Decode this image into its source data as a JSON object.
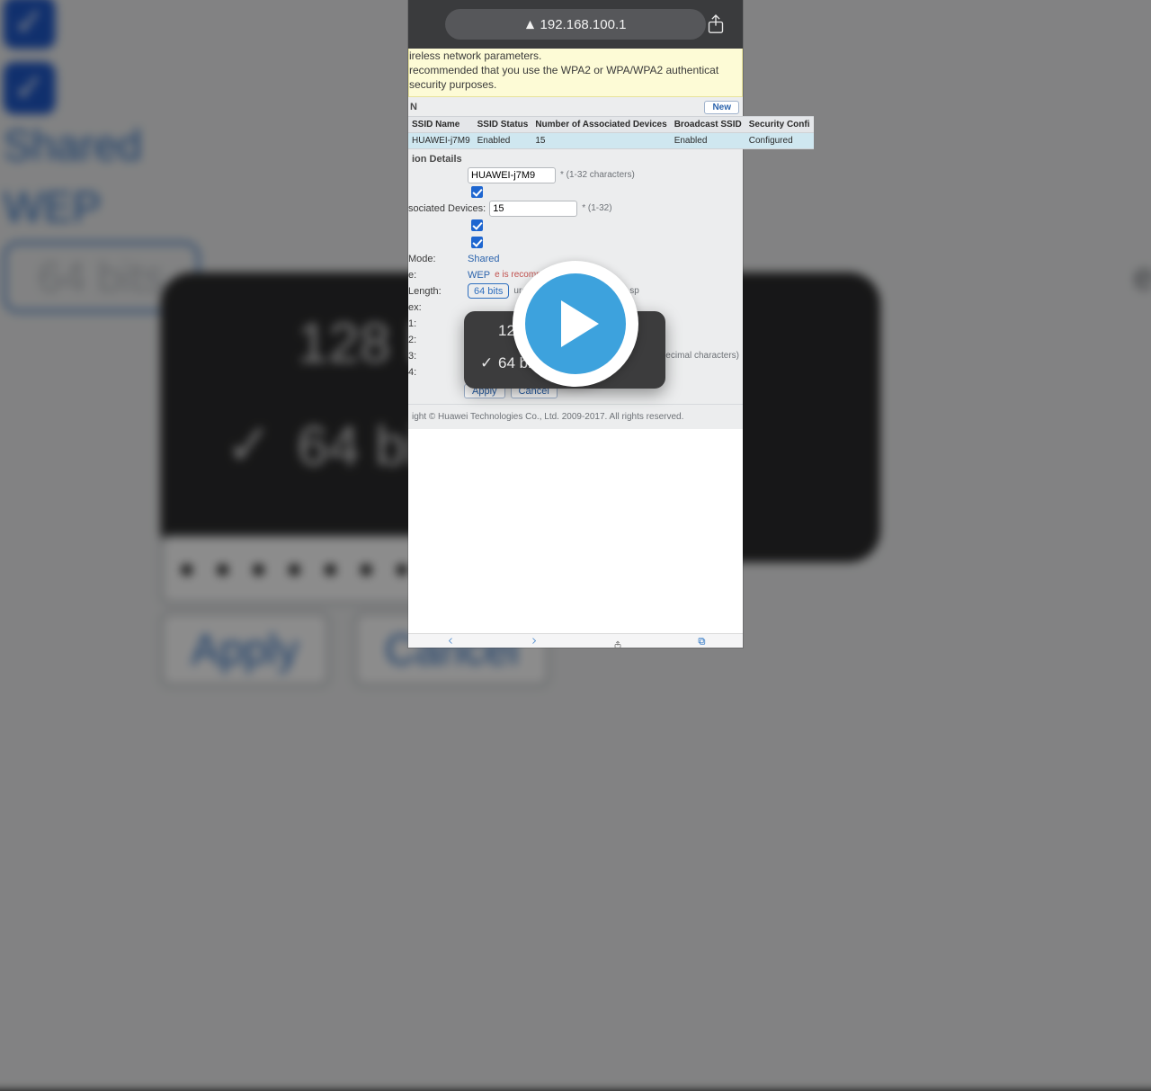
{
  "top": {
    "address": "192.168.100.1"
  },
  "hint": {
    "l1": "ireless network parameters.",
    "l2": "recommended that you use the WPA2 or WPA/WPA2 authenticat",
    "l3": " security purposes."
  },
  "section_title": "N",
  "new_btn": "New",
  "table": {
    "headers": [
      "SSID Name",
      "SSID Status",
      "Number of Associated Devices",
      "Broadcast SSID",
      "Security Confi"
    ],
    "row": [
      "HUAWEI-j7M9",
      "Enabled",
      "15",
      "Enabled",
      "Configured"
    ]
  },
  "details_hdr": "ion Details",
  "fields": {
    "ssid_name": {
      "label": "",
      "value": "HUAWEI-j7M9",
      "note": "* (1-32 characters)"
    },
    "enable_ck": true,
    "assoc": {
      "label": "sociated Devices:",
      "value": "15",
      "note": "* (1-32)"
    },
    "ck2": true,
    "ck3": true,
    "mode": {
      "label": "Mode:",
      "value": "Shared"
    },
    "enc": {
      "label": "e:",
      "value": "WEP",
      "red": "e is recommended)"
    },
    "len": {
      "label": "Length:",
      "value": "64 bits",
      "gray": "ure but affect the connection sp"
    },
    "idx": {
      "label": "ex:"
    },
    "k1": {
      "label": "1:"
    },
    "k2": {
      "label": "2:"
    },
    "k3": {
      "label": "3:",
      "hx": "adecimal characters)"
    },
    "k4": {
      "label": "4:",
      "value": "•••••••••••••"
    }
  },
  "dropdown": {
    "opt0": "128",
    "opt1": "64 bit",
    "selected": 1
  },
  "apply": "Apply",
  "cancel": "Cancel",
  "copyright": "ight © Huawei Technologies Co., Ltd. 2009-2017. All rights reserved.",
  "bg": {
    "mode_label": "Mode:",
    "mode_val": "Shared",
    "enc_label": "e:",
    "enc_val": "WEP",
    "enc_red": "de is recommended)",
    "len_label": "Length:",
    "len_val": "64 bits",
    "len_gray": "e secure but affect the connection sp",
    "idx_label": "ex:",
    "k1_label": "1:",
    "k2_label": "2:",
    "k3_label": "3:",
    "k4_label": "4:",
    "hx": "(adecimal characters)",
    "pw": "• • • • • • • • • • • • •",
    "pop0": "128 bi",
    "pop1": "64 bit",
    "apply": "Apply",
    "cancel": "Cancel"
  }
}
